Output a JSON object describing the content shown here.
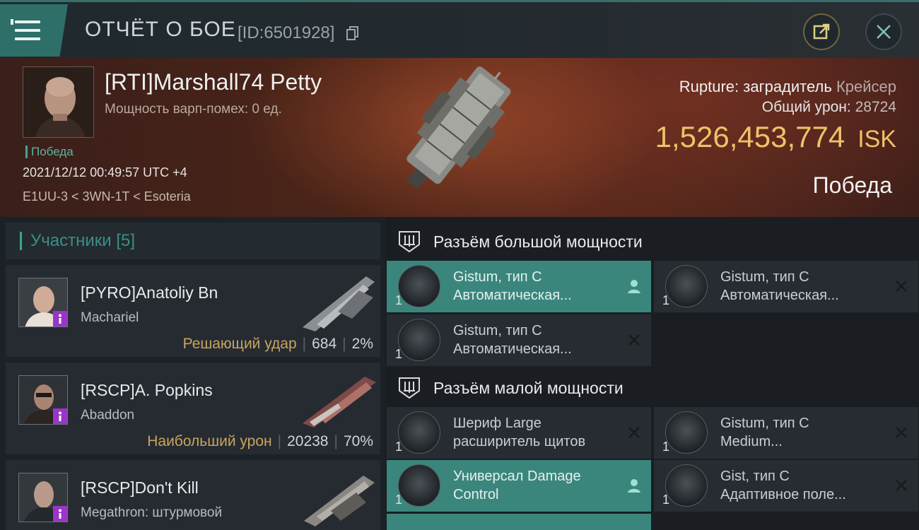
{
  "header": {
    "title": "ОТЧЁТ О БОЕ",
    "report_id": "[ID:6501928]"
  },
  "victim": {
    "name": "[RTI]Marshall74 Petty",
    "warp_disrupt": "Мощность варп-помех: 0 ед.",
    "status": "Победа",
    "datetime": "2021/12/12 00:49:57 UTC +4",
    "location": "E1UU-3 < 3WN-1T < Esoteria",
    "ship_name": "Rupture: заградитель",
    "ship_class": "Крейсер",
    "damage_label": "Общий урон:",
    "damage_value": "28724",
    "isk_value": "1,526,453,774",
    "isk_unit": "ISK",
    "result": "Победа"
  },
  "participants": {
    "title": "Участники [5]",
    "items": [
      {
        "name": "[PYRO]Anatoliy Bn",
        "ship": "Machariel",
        "tag": "Решающий удар",
        "damage": "684",
        "percent": "2%"
      },
      {
        "name": "[RSCP]A. Popkins",
        "ship": "Abaddon",
        "tag": "Наибольший урон",
        "damage": "20238",
        "percent": "70%"
      },
      {
        "name": "[RSCP]Don't Kill",
        "ship": "Megathron: штурмовой",
        "tag": "",
        "damage": "",
        "percent": ""
      }
    ]
  },
  "fittings": {
    "high_title": "Разъём большой мощности",
    "low_title": "Разъём малой мощности",
    "modules": [
      {
        "count": "1",
        "line1": "Gistum, тип C",
        "line2": "Автоматическая...",
        "action": "person-icon"
      },
      {
        "count": "1",
        "line1": "Gistum, тип C",
        "line2": "Автоматическая...",
        "action": "close-icon"
      },
      {
        "count": "1",
        "line1": "Gistum, тип C",
        "line2": "Автоматическая...",
        "action": "close-icon"
      },
      {
        "count": "1",
        "line1": "Шериф Large",
        "line2": "расширитель щитов",
        "action": "close-icon"
      },
      {
        "count": "1",
        "line1": "Gistum, тип C",
        "line2": "Medium...",
        "action": "close-icon"
      },
      {
        "count": "1",
        "line1": "Универсал Damage",
        "line2": "Control",
        "action": "person-icon"
      },
      {
        "count": "1",
        "line1": "Gist, тип C",
        "line2": "Адаптивное поле...",
        "action": "close-icon"
      }
    ]
  },
  "colors": {
    "accent": "#3b867c",
    "gold": "#f0c167",
    "tag": "#c9a45e",
    "badge": "#9a35c8"
  }
}
